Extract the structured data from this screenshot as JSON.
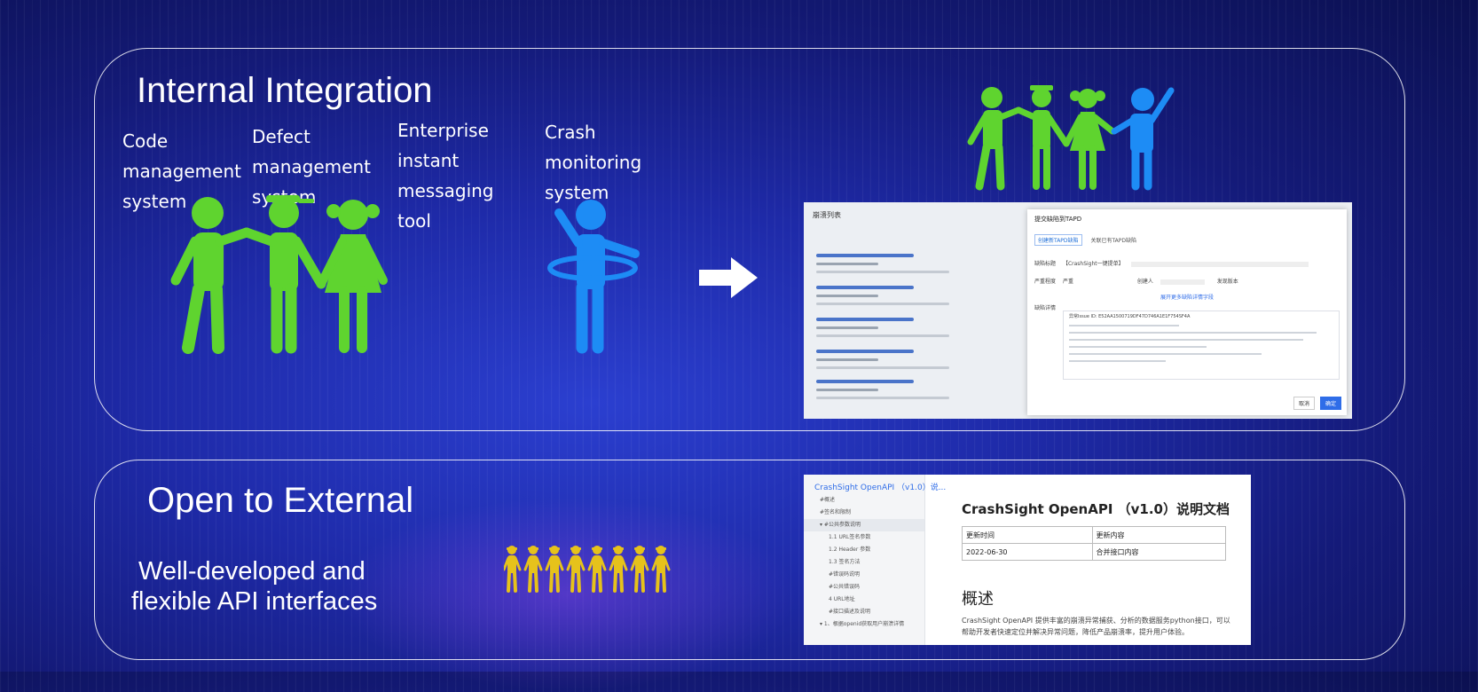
{
  "colors": {
    "green": "#5fd42f",
    "blue": "#1d8cf5",
    "yellow": "#e6c21b",
    "panel_border": "#ffffff"
  },
  "internal": {
    "title": "Internal Integration",
    "systems": [
      {
        "label": "Code\nmanagement\nsystem"
      },
      {
        "label": "Defect\nmanagement\nsystem"
      },
      {
        "label": "Enterprise\ninstant\nmessaging\ntool"
      },
      {
        "label": "Crash\nmonitoring\nsystem"
      }
    ]
  },
  "external": {
    "title": "Open to External",
    "subtitle_line1": "Well-developed and",
    "subtitle_line2": "flexible API interfaces"
  },
  "defect_screenshot": {
    "list_title": "崩溃列表",
    "modal_title": "提交缺陷到TAPD",
    "tab_new": "创建新TAPD缺陷",
    "tab_link": "关联已有TAPD缺陷",
    "field_title": "缺陷标题",
    "field_title_value": "【CrashSight一键提单】",
    "field_severity": "严重程度",
    "field_severity_value": "严重",
    "field_creator": "创建人",
    "field_version": "发现版本",
    "expand_link": "展开更多缺陷详情字段",
    "field_detail": "缺陷详情",
    "detail_first_line": "异常Issue ID: E52AA1500719DF47D746A1E1F754SF4A",
    "btn_cancel": "取消",
    "btn_ok": "确定"
  },
  "api_doc": {
    "nav_title": "CrashSight OpenAPI （v1.0）说...",
    "nav_items": [
      {
        "label": "#概述",
        "level": "top",
        "active": false
      },
      {
        "label": "#签名和限制",
        "level": "top",
        "active": false
      },
      {
        "label": "▾ #公共参数说明",
        "level": "top",
        "active": true
      },
      {
        "label": "1.1 URL签名参数",
        "level": "sub",
        "active": false
      },
      {
        "label": "1.2 Header 参数",
        "level": "sub",
        "active": false
      },
      {
        "label": "1.3 签名方法",
        "level": "sub",
        "active": false
      },
      {
        "label": "#错误码说明",
        "level": "sub",
        "active": false
      },
      {
        "label": "#公共错误码",
        "level": "sub",
        "active": false
      },
      {
        "label": "4 URL地址",
        "level": "sub",
        "active": false
      },
      {
        "label": "#接口描述及说明",
        "level": "sub",
        "active": false
      },
      {
        "label": "▾ 1、根据openid获取用户崩溃详情",
        "level": "top",
        "active": false
      }
    ],
    "doc_title": "CrashSight OpenAPI （v1.0）说明文档",
    "table_headers": [
      "更新时间",
      "更新内容"
    ],
    "table_rows": [
      [
        "2022-06-30",
        "合并接口内容"
      ]
    ],
    "section_title": "概述",
    "section_text": "CrashSight OpenAPI 提供丰富的崩溃异常捕获、分析的数据服务python接口，可以帮助开发者快速定位并解决异常问题，降低产品崩溃率，提升用户体验。"
  }
}
